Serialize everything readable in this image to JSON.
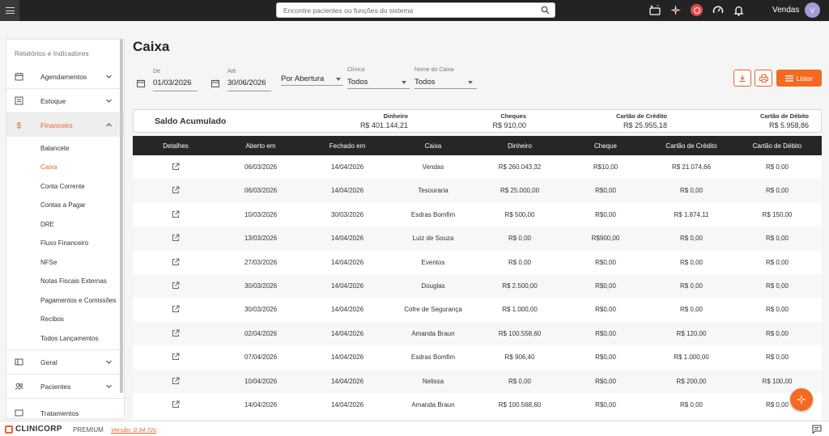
{
  "topbar": {
    "search_placeholder": "Encontre pacientes ou funções do sistema",
    "user_name": "Vendas",
    "avatar_initial": "V"
  },
  "sidebar": {
    "title": "Relatórios e Indicadores",
    "groups": [
      {
        "label": "Agendamentos",
        "icon": "calendar-icon"
      },
      {
        "label": "Estoque",
        "icon": "box-icon"
      },
      {
        "label": "Financeiro",
        "icon": "dollar-icon"
      },
      {
        "label": "Geral",
        "icon": "card-icon"
      },
      {
        "label": "Pacientes",
        "icon": "users-icon"
      },
      {
        "label": "Tratamentos",
        "icon": "tooth-icon"
      }
    ],
    "financeiro_items": [
      "Balancete",
      "Caixa",
      "Conta Corrente",
      "Contas a Pagar",
      "DRE",
      "Fluxo Financeiro",
      "NFSe",
      "Notas Fiscais Externas",
      "Pagamentos e Comissões",
      "Recibos",
      "Todos Lançamentos"
    ]
  },
  "page": {
    "title": "Caixa"
  },
  "filters": {
    "de_label": "De",
    "de_value": "01/03/2026",
    "ate_label": "Até",
    "ate_value": "30/06/2026",
    "modo_value": "Por Abertura",
    "clinica_label": "Clínica",
    "clinica_value": "Todos",
    "caixa_label": "Nome do Caixa",
    "caixa_value": "Todos",
    "listar_label": "Listar"
  },
  "saldo": {
    "title": "Saldo Acumulado",
    "columns": [
      {
        "header": "Dinheiro",
        "value": "R$ 401.144,21"
      },
      {
        "header": "Cheques",
        "value": "R$ 910,00"
      },
      {
        "header": "Cartão de Crédito",
        "value": "R$ 25.955,18"
      },
      {
        "header": "Cartão de Débito",
        "value": "R$ 5.958,86"
      }
    ]
  },
  "table": {
    "headers": [
      "Detalhes",
      "Aberto em",
      "Fechado em",
      "Caixa",
      "Dinheiro",
      "Cheque",
      "Cartão de Crédito",
      "Cartão de Débito"
    ],
    "rows": [
      [
        "06/03/2026",
        "14/04/2026",
        "Vendas",
        "R$ 260.043,32",
        "R$10,00",
        "R$ 21.074,66",
        "R$ 0,00"
      ],
      [
        "06/03/2026",
        "14/04/2026",
        "Tesouraria",
        "R$ 25.000,00",
        "R$0,00",
        "R$ 0,00",
        "R$ 0,00"
      ],
      [
        "10/03/2026",
        "30/03/2026",
        "Esdras Bomfim",
        "R$ 500,00",
        "R$0,00",
        "R$ 1.874,11",
        "R$ 150,00"
      ],
      [
        "13/03/2026",
        "14/04/2026",
        "Luiz de Souza",
        "R$ 0,00",
        "R$900,00",
        "R$ 0,00",
        "R$ 0,00"
      ],
      [
        "27/03/2026",
        "14/04/2026",
        "Eventos",
        "R$ 0,00",
        "R$0,00",
        "R$ 0,00",
        "R$ 0,00"
      ],
      [
        "30/03/2026",
        "14/04/2026",
        "Douglas",
        "R$ 2.500,00",
        "R$0,00",
        "R$ 0,00",
        "R$ 0,00"
      ],
      [
        "30/03/2026",
        "14/04/2026",
        "Cofre de Segurança",
        "R$ 1.000,00",
        "R$0,00",
        "R$ 0,00",
        "R$ 0,00"
      ],
      [
        "02/04/2026",
        "14/04/2026",
        "Amanda Braun",
        "R$ 100.558,60",
        "R$0,00",
        "R$ 120,00",
        "R$ 0,00"
      ],
      [
        "07/04/2026",
        "14/04/2026",
        "Esdras Bomfim",
        "R$ 906,40",
        "R$0,00",
        "R$ 1.000,00",
        "R$ 0,00"
      ],
      [
        "10/04/2026",
        "14/04/2026",
        "Nelissa",
        "R$ 0,00",
        "R$0,00",
        "R$ 200,00",
        "R$ 100,00"
      ],
      [
        "14/04/2026",
        "14/04/2026",
        "Amanda Braun",
        "R$ 100.568,60",
        "R$0,00",
        "R$ 0,00",
        "R$ 0,00"
      ]
    ]
  },
  "footer": {
    "brand": "CLINICORP",
    "plan": "PREMIUM",
    "version": "Versão: 0.34.72c"
  },
  "colors": {
    "accent": "#f26b21",
    "topbar": "#232323",
    "table_header": "#262626"
  }
}
